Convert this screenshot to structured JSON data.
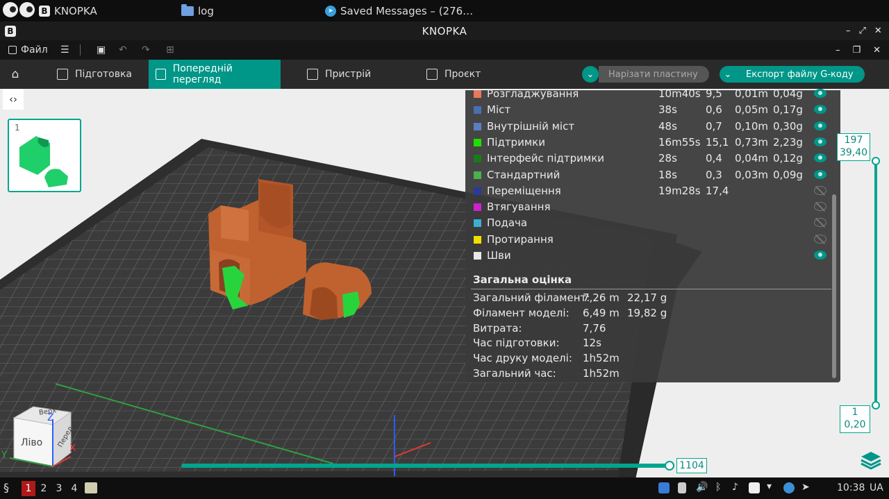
{
  "os_panel": {
    "tasks": [
      {
        "label": "KNOPKA"
      },
      {
        "label": "log"
      },
      {
        "label": "Saved Messages – (276…"
      }
    ]
  },
  "window": {
    "title": "KNOPKA"
  },
  "menubar": {
    "file_label": "Файл"
  },
  "tabs": [
    {
      "label": "Підготовка",
      "icon": "cube-icon"
    },
    {
      "label": "Попередній перегляд",
      "icon": "layers-icon"
    },
    {
      "label": "Пристрій",
      "icon": "device-icon"
    },
    {
      "label": "Проєкт",
      "icon": "project-icon"
    }
  ],
  "actions": {
    "slice_label": "Нарізати пластину",
    "export_label": "Експорт файлу G-коду"
  },
  "plate": {
    "number": "1"
  },
  "stats": {
    "rows": [
      {
        "name": "Розгладжування",
        "color": "#e8785a",
        "time": "10m40s",
        "pct": "9,5",
        "len": "0,01m",
        "weight": "0,04g",
        "visible": true
      },
      {
        "name": "Міст",
        "color": "#4a6fb0",
        "time": "38s",
        "pct": "0,6",
        "len": "0,05m",
        "weight": "0,17g",
        "visible": true
      },
      {
        "name": "Внутрішній міст",
        "color": "#5a7fc0",
        "time": "48s",
        "pct": "0,7",
        "len": "0,10m",
        "weight": "0,30g",
        "visible": true
      },
      {
        "name": "Підтримки",
        "color": "#1ee000",
        "time": "16m55s",
        "pct": "15,1",
        "len": "0,73m",
        "weight": "2,23g",
        "visible": true
      },
      {
        "name": "Інтерфейс підтримки",
        "color": "#1a7a1a",
        "time": "28s",
        "pct": "0,4",
        "len": "0,04m",
        "weight": "0,12g",
        "visible": true
      },
      {
        "name": "Стандартний",
        "color": "#4caf50",
        "time": "18s",
        "pct": "0,3",
        "len": "0,03m",
        "weight": "0,09g",
        "visible": true
      },
      {
        "name": "Переміщення",
        "color": "#2a3a9a",
        "time": "19m28s",
        "pct": "17,4",
        "len": "",
        "weight": "",
        "visible": false
      },
      {
        "name": "Втягування",
        "color": "#cc22cc",
        "time": "",
        "pct": "",
        "len": "",
        "weight": "",
        "visible": false
      },
      {
        "name": "Подача",
        "color": "#3cb0d0",
        "time": "",
        "pct": "",
        "len": "",
        "weight": "",
        "visible": false
      },
      {
        "name": "Протирання",
        "color": "#f0e000",
        "time": "",
        "pct": "",
        "len": "",
        "weight": "",
        "visible": false
      },
      {
        "name": "Шви",
        "color": "#e8e8e8",
        "time": "",
        "pct": "",
        "len": "",
        "weight": "",
        "visible": true
      }
    ],
    "summary_title": "Загальна оцінка",
    "summary": [
      {
        "label": "Загальний філамент:",
        "v1": "7,26 m",
        "v2": "22,17 g"
      },
      {
        "label": "Філамент моделі:",
        "v1": "6,49 m",
        "v2": "19,82 g"
      },
      {
        "label": "Витрата:",
        "v1": "7,76",
        "v2": ""
      },
      {
        "label": "Час підготовки:",
        "v1": "12s",
        "v2": ""
      },
      {
        "label": "Час друку моделі:",
        "v1": "1h52m",
        "v2": ""
      },
      {
        "label": "Загальний час:",
        "v1": "1h52m",
        "v2": ""
      }
    ]
  },
  "layer_slider": {
    "top_layer": "197",
    "top_height": "39,40",
    "bottom_layer": "1",
    "bottom_height": "0,20"
  },
  "move_slider": {
    "value": "1104"
  },
  "view_cube": {
    "top": "Верх",
    "front": "Перед",
    "left": "Ліво",
    "axis_x": "X",
    "axis_y": "Y",
    "axis_z": "Z"
  },
  "taskbar": {
    "workspaces": [
      "1",
      "2",
      "3",
      "4"
    ],
    "clock": "10:38",
    "lang": "UA"
  },
  "colors": {
    "accent": "#009688",
    "model": "#c8693a",
    "support": "#20d840"
  }
}
